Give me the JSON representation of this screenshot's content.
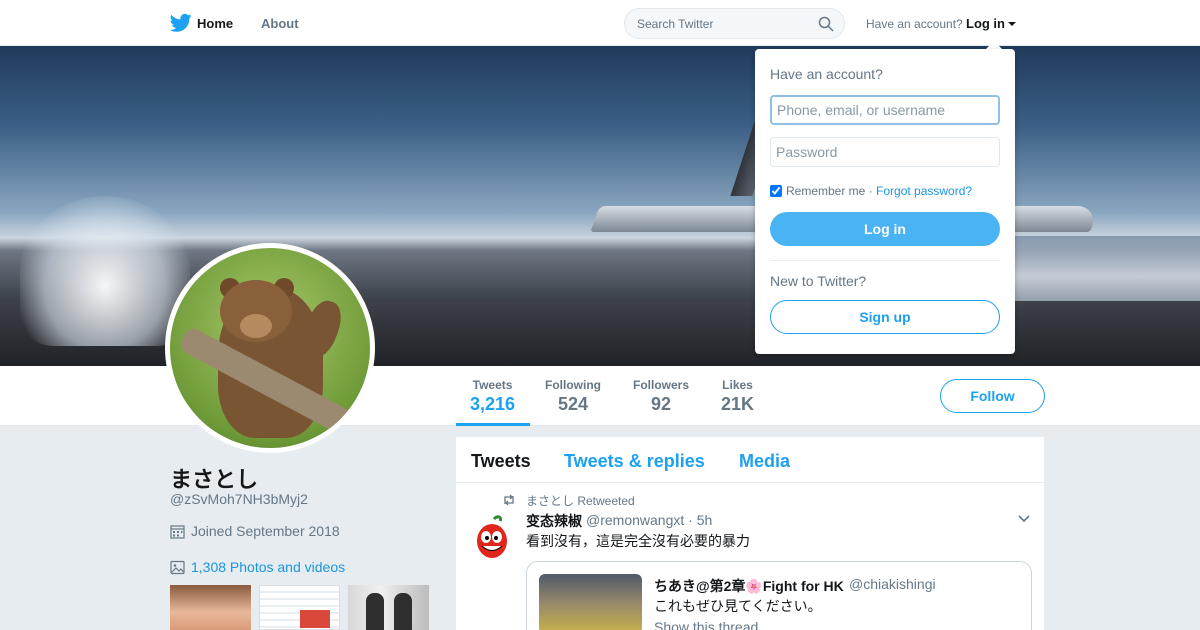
{
  "nav": {
    "home_label": "Home",
    "about_label": "About",
    "search_placeholder": "Search Twitter",
    "account_question": "Have an account?",
    "login_label": "Log in",
    "brand_color": "#1da1f2"
  },
  "profile": {
    "display_name": "まさとし",
    "handle": "@zSvMoh7NH3bMyj2",
    "joined": "Joined September 2018",
    "photos_videos": "1,308 Photos and videos",
    "follow_label": "Follow",
    "stats": [
      {
        "label": "Tweets",
        "value": "3,216"
      },
      {
        "label": "Following",
        "value": "524"
      },
      {
        "label": "Followers",
        "value": "92"
      },
      {
        "label": "Likes",
        "value": "21K"
      }
    ]
  },
  "timeline": {
    "tabs": [
      "Tweets",
      "Tweets & replies",
      "Media"
    ],
    "tweet": {
      "retweeted_by": "まさとし Retweeted",
      "author_name": "变态辣椒",
      "author_handle": "@remonwangxt · 5h",
      "text": "看到沒有，這是完全沒有必要的暴力",
      "quote": {
        "author_name": "ちあき@第2章🌸Fight for HK",
        "author_handle": "@chiakishingi",
        "text": "これもぜひ見てください。",
        "thread_link": "Show this thread"
      }
    }
  },
  "login_dropdown": {
    "title": "Have an account?",
    "username_placeholder": "Phone, email, or username",
    "password_placeholder": "Password",
    "remember_label": "Remember me",
    "separator": " · ",
    "forgot_label": "Forgot password?",
    "login_button": "Log in",
    "new_user_text": "New to Twitter?",
    "signup_button": "Sign up"
  }
}
